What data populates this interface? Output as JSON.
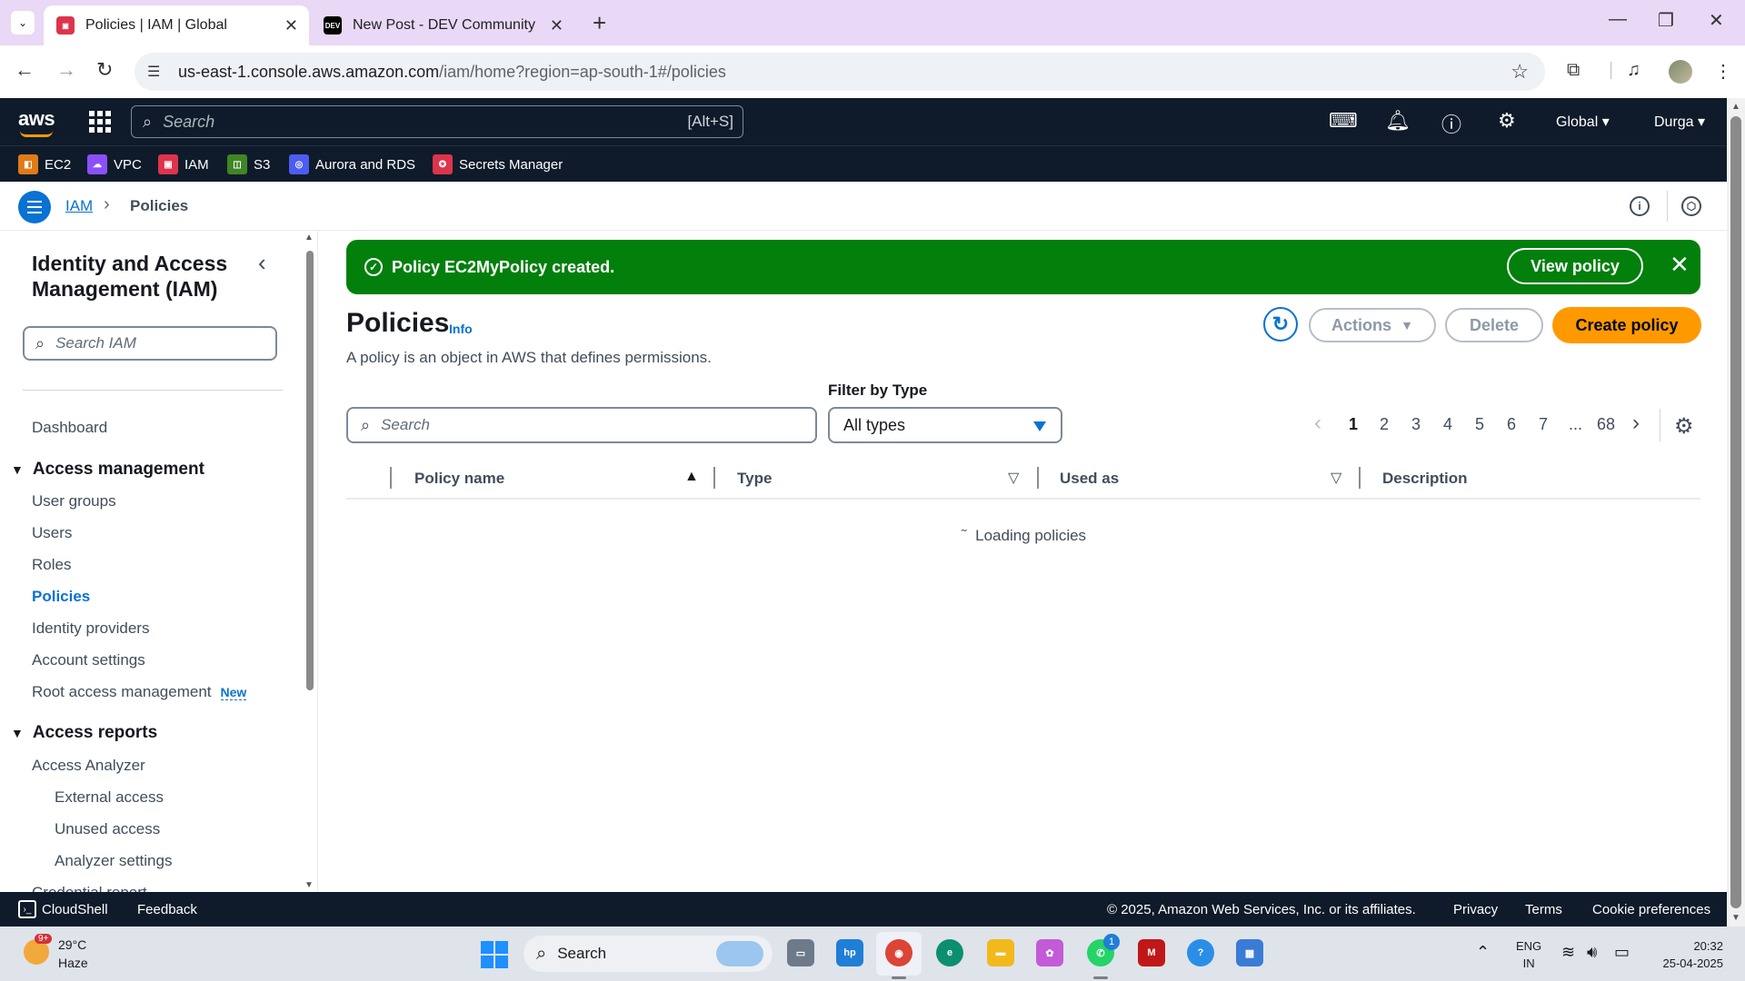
{
  "browser": {
    "tabs": [
      {
        "title": "Policies | IAM | Global",
        "favicon": "aws-iam-favicon",
        "active": true
      },
      {
        "title": "New Post - DEV Community",
        "favicon": "DEV",
        "active": false
      }
    ],
    "url_host": "us-east-1.console.aws.amazon.com",
    "url_path": "/iam/home?region=ap-south-1#/policies"
  },
  "aws_nav": {
    "logo": "aws",
    "search_placeholder": "Search",
    "search_shortcut": "[Alt+S]",
    "region": "Global",
    "user": "Durga"
  },
  "favorites": [
    {
      "label": "EC2",
      "color": "#e07b17"
    },
    {
      "label": "VPC",
      "color": "#8c4fff"
    },
    {
      "label": "IAM",
      "color": "#dd344c"
    },
    {
      "label": "S3",
      "color": "#3f8624"
    },
    {
      "label": "Aurora and RDS",
      "color": "#4d5cf0"
    },
    {
      "label": "Secrets Manager",
      "color": "#dd344c"
    }
  ],
  "breadcrumb": {
    "root": "IAM",
    "current": "Policies"
  },
  "sidebar": {
    "title": "Identity and Access Management (IAM)",
    "search_placeholder": "Search IAM",
    "dashboard": "Dashboard",
    "access_management": {
      "heading": "Access management",
      "items": [
        "User groups",
        "Users",
        "Roles",
        "Policies",
        "Identity providers",
        "Account settings",
        "Root access management"
      ],
      "new_badge": "New"
    },
    "access_reports": {
      "heading": "Access reports",
      "analyzer": "Access Analyzer",
      "sub_items": [
        "External access",
        "Unused access",
        "Analyzer settings"
      ],
      "partial": "Credential report"
    }
  },
  "flash": {
    "message": "Policy EC2MyPolicy created.",
    "button": "View policy",
    "color": "#037f0c"
  },
  "page": {
    "title": "Policies",
    "info": "Info",
    "description": "A policy is an object in AWS that defines permissions.",
    "actions": "Actions",
    "delete": "Delete",
    "create": "Create policy"
  },
  "table": {
    "search_placeholder": "Search",
    "filter_label": "Filter by Type",
    "filter_value": "All types",
    "pages": [
      "1",
      "2",
      "3",
      "4",
      "5",
      "6",
      "7",
      "...",
      "68"
    ],
    "current_page": "1",
    "columns": [
      "Policy name",
      "Type",
      "Used as",
      "Description"
    ],
    "loading_text": "Loading policies"
  },
  "footer": {
    "cloudshell": "CloudShell",
    "feedback": "Feedback",
    "copyright": "© 2025, Amazon Web Services, Inc. or its affiliates.",
    "privacy": "Privacy",
    "terms": "Terms",
    "cookies": "Cookie preferences"
  },
  "taskbar": {
    "weather_temp": "29°C",
    "weather_desc": "Haze",
    "weather_badge": "9+",
    "search": "Search",
    "whatsapp_badge": "1",
    "lang_top": "ENG",
    "lang_bottom": "IN",
    "time": "20:32",
    "date": "25-04-2025"
  }
}
